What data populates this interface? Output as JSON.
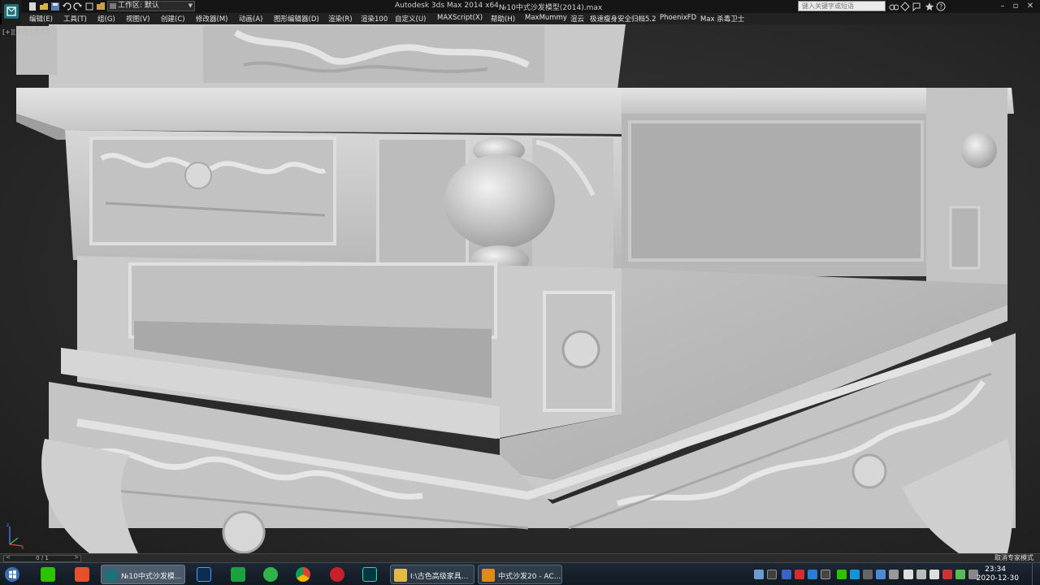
{
  "titlebar": {
    "workspace_label": "工作区: 默认",
    "app_title": "Autodesk 3ds Max  2014 x64",
    "doc_title": "№10中式沙发模型(2014).max",
    "search_placeholder": "键入关键字或短语"
  },
  "menu": {
    "items": [
      "编辑(E)",
      "工具(T)",
      "组(G)",
      "视图(V)",
      "创建(C)",
      "修改器(M)",
      "动画(A)",
      "图形编辑器(D)",
      "渲染(R)",
      "渲染100",
      "自定义(U)",
      "MAXScript(X)",
      "帮助(H)",
      "MaxMummy",
      "渲云",
      "极速瘦身安全归档5.2",
      "PhoenixFD",
      "Max 杀毒卫士"
    ]
  },
  "viewport": {
    "label": "[+][透视][真实]"
  },
  "status": {
    "time_slider": "0 / 1",
    "expert_mode": "取消专家模式"
  },
  "taskbar": {
    "windows": [
      {
        "label": "№10中式沙发模...",
        "active": true
      },
      {
        "label": "I:\\古色高级家具...",
        "active": false
      },
      {
        "label": "中式沙发20 - AC...",
        "active": false
      }
    ],
    "clock_time": "23:34",
    "clock_date": "2020-12-30"
  },
  "colors": {
    "titlebar_bg": "#151515",
    "menubar_bg": "#222222",
    "viewport_bg": "#2c2c2c",
    "model_fill": "#cfcfcf",
    "taskbar_bg": "#16202a"
  },
  "icons": {
    "app_logo": "3ds-max-logo-icon",
    "taskbar_apps": [
      "wechat-icon",
      "camtasia-icon",
      "3dsmax-icon",
      "photoshop-icon",
      "green-app-icon",
      "qq-browser-icon",
      "chrome-icon",
      "sketchup-icon",
      "audition-icon",
      "folder-icon",
      "acdsee-icon"
    ]
  }
}
